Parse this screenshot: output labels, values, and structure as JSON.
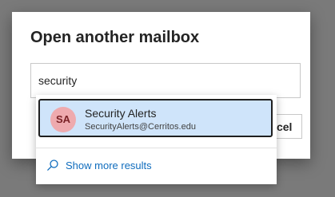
{
  "dialog": {
    "title": "Open another mailbox",
    "search_value": "security",
    "cancel_label": "Cancel"
  },
  "suggestions": {
    "items": [
      {
        "initials": "SA",
        "name": "Security Alerts",
        "email": "SecurityAlerts@Cerritos.edu",
        "avatar_color": "#eeaaae"
      }
    ],
    "more_results_label": "Show more results",
    "more_results_icon": "search-icon"
  },
  "colors": {
    "highlight": "#cfe4fa",
    "link": "#0f6cbd",
    "overlay": "#7a7a7a"
  }
}
